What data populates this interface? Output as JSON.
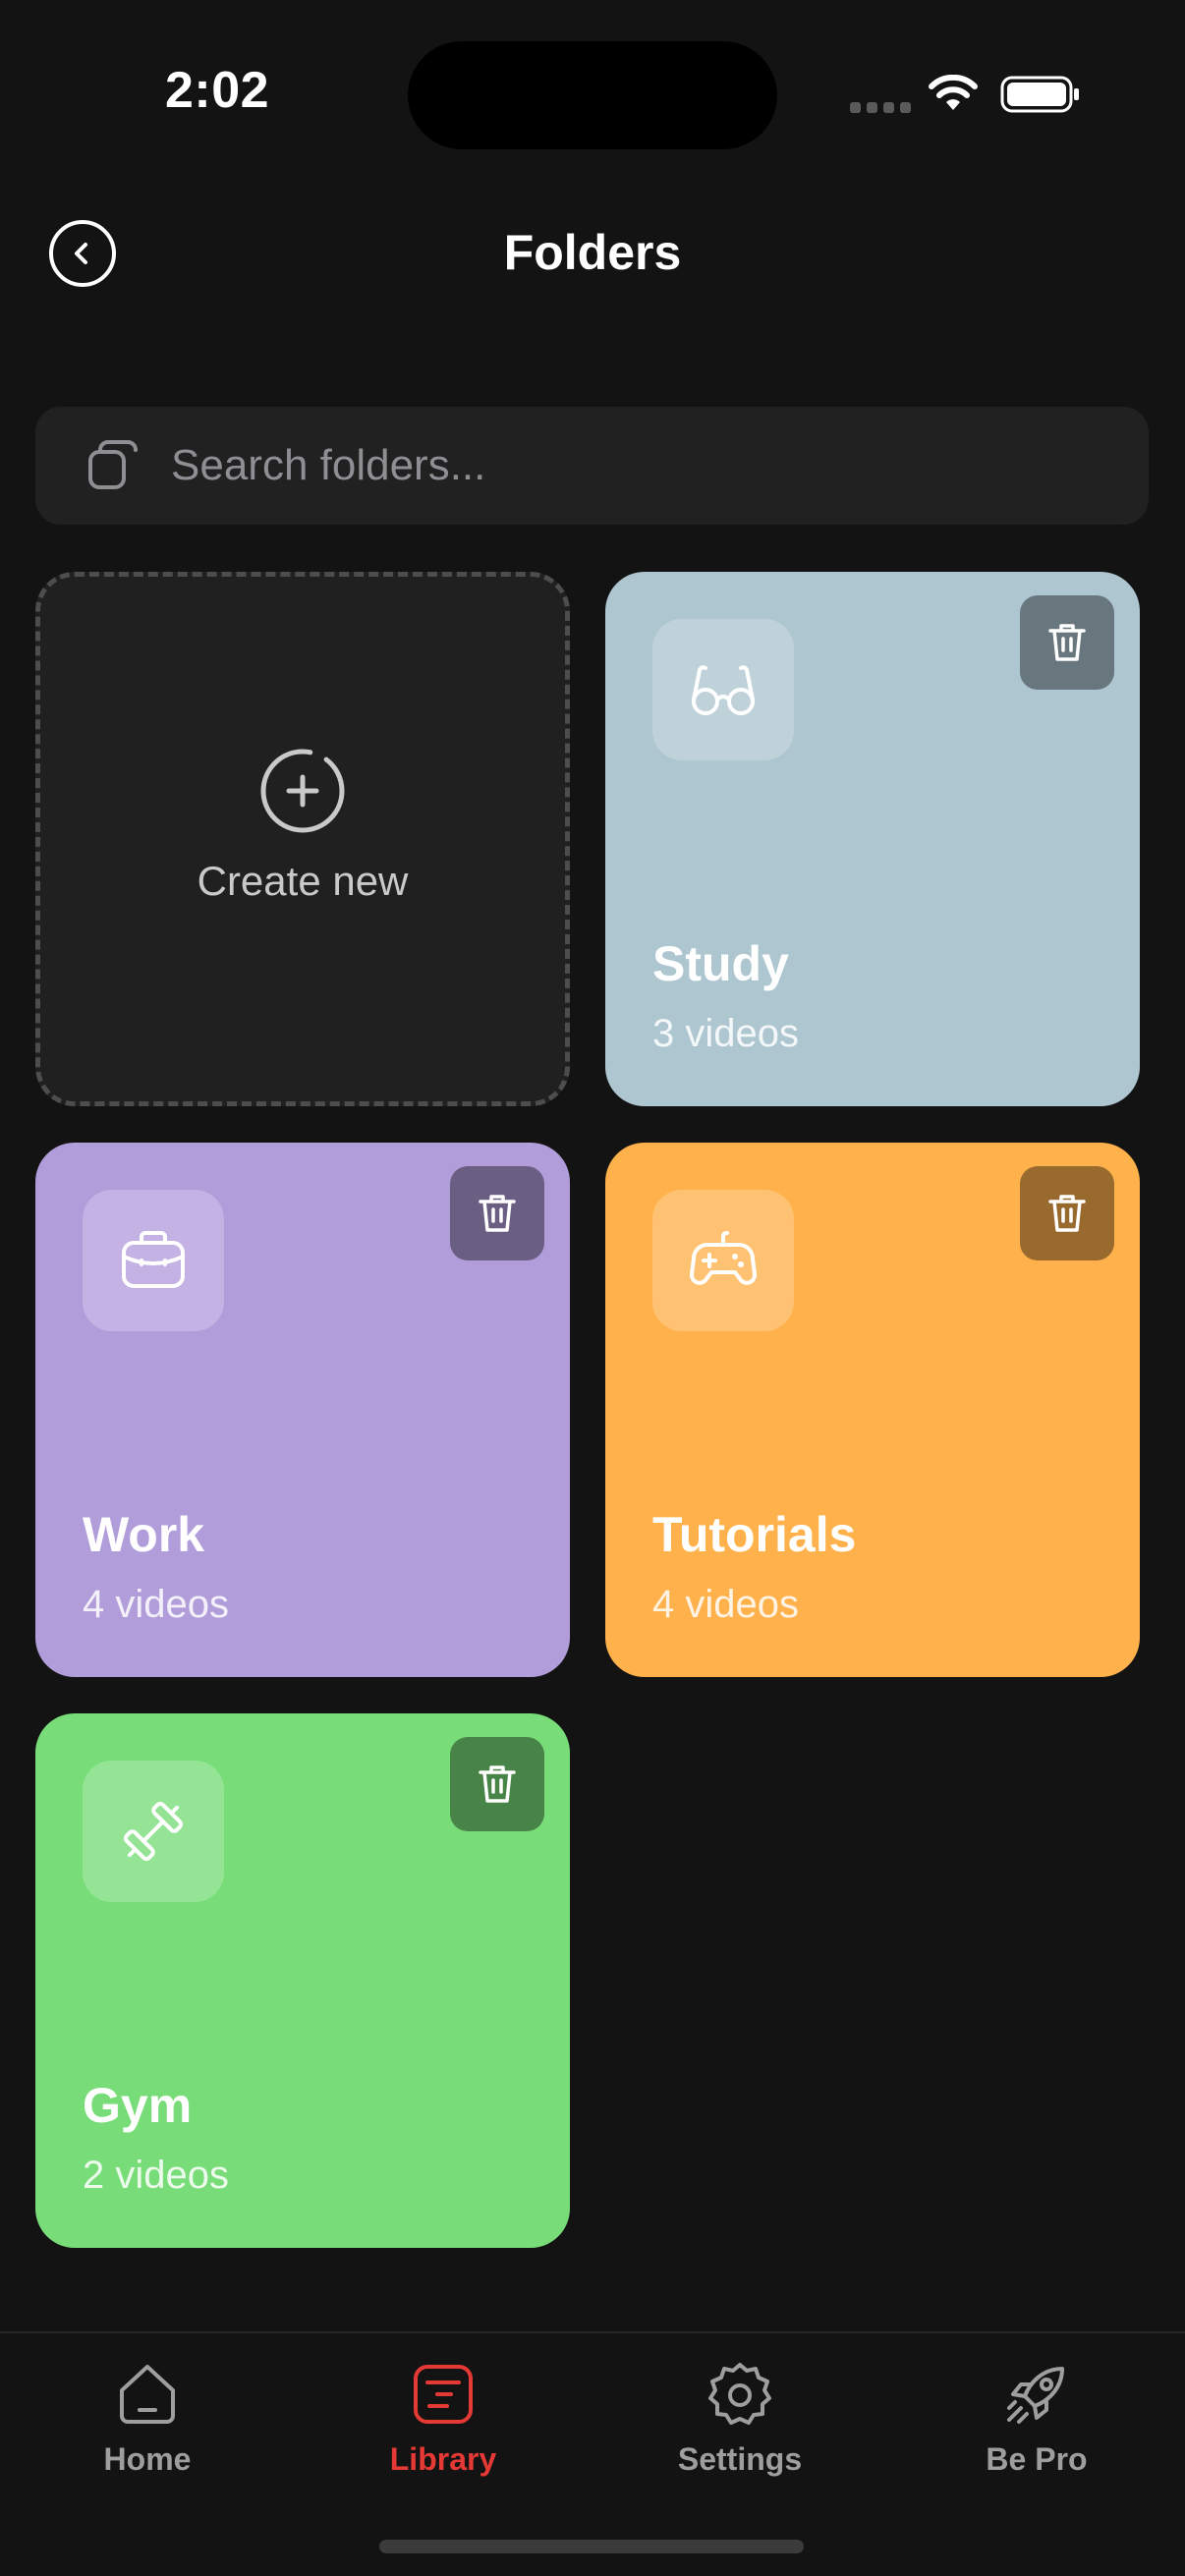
{
  "status_bar": {
    "time": "2:02"
  },
  "header": {
    "title": "Folders",
    "back_icon": "chevron-left-icon"
  },
  "search": {
    "placeholder": "Search folders...",
    "value": "",
    "icon": "copy-folders-icon"
  },
  "create_card": {
    "label": "Create new",
    "icon": "plus-circle-icon"
  },
  "folders": [
    {
      "name": "Study",
      "count": "3 videos",
      "icon": "glasses-icon",
      "color": "#adc6d0"
    },
    {
      "name": "Work",
      "count": "4 videos",
      "icon": "briefcase-icon",
      "color": "#b29ddb"
    },
    {
      "name": "Tutorials",
      "count": "4 videos",
      "icon": "gamepad-icon",
      "color": "#ffb14b"
    },
    {
      "name": "Gym",
      "count": "2 videos",
      "icon": "dumbbell-icon",
      "color": "#78dd79"
    }
  ],
  "tabs": [
    {
      "label": "Home",
      "icon": "home-icon",
      "active": false
    },
    {
      "label": "Library",
      "icon": "library-icon",
      "active": true
    },
    {
      "label": "Settings",
      "icon": "gear-icon",
      "active": false
    },
    {
      "label": "Be Pro",
      "icon": "rocket-icon",
      "active": false
    }
  ],
  "colors": {
    "background": "#131313",
    "accent": "#e53935",
    "inactive": "#9e9e9e"
  }
}
